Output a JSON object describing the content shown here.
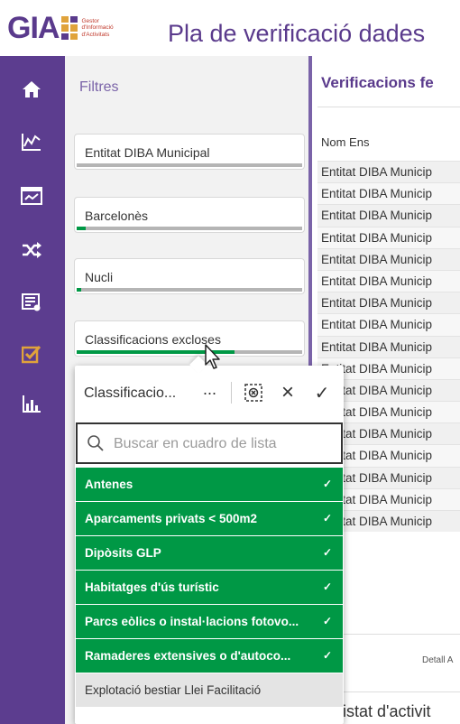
{
  "header": {
    "logo": "GIA",
    "logo_sub": [
      "Gestor",
      "d'Informació",
      "d'Activitats"
    ],
    "title": "Pla de verificació dades"
  },
  "rail": {
    "items": [
      "home-icon",
      "line-chart-icon",
      "dashboard-icon",
      "shuffle-icon",
      "report-icon",
      "checkbox-icon",
      "bar-chart-icon"
    ],
    "active_color": "#e0a33b"
  },
  "filters": {
    "title": "Filtres",
    "items": [
      {
        "label": "Entitat DIBA Municipal",
        "progress": 0
      },
      {
        "label": "Barcelonès",
        "progress": 0.04
      },
      {
        "label": "Nucli",
        "progress": 0.02
      },
      {
        "label": "Classificacions excloses",
        "progress": 0.7
      }
    ]
  },
  "table": {
    "title": "Verificacions fe",
    "column": "Nom Ens",
    "rows": [
      "Entitat DIBA Municip",
      "Entitat DIBA Municip",
      "Entitat DIBA Municip",
      "Entitat DIBA Municip",
      "Entitat DIBA Municip",
      "Entitat DIBA Municip",
      "Entitat DIBA Municip",
      "Entitat DIBA Municip",
      "Entitat DIBA Municip",
      "Entitat DIBA Municip",
      "Entitat DIBA Municip",
      "Entitat DIBA Municip",
      "Entitat DIBA Municip",
      "Entitat DIBA Municip",
      "Entitat DIBA Municip",
      "Entitat DIBA Municip",
      "Entitat DIBA Municip"
    ],
    "detail_link": "Detall A",
    "listat_title": "listat d'activit"
  },
  "popover": {
    "title": "Classificacio...",
    "more": "···",
    "close": "×",
    "confirm": "✓",
    "search_placeholder": "Buscar en cuadro de lista",
    "options": [
      {
        "label": "Antenes",
        "selected": true
      },
      {
        "label": "Aparcaments privats < 500m2",
        "selected": true
      },
      {
        "label": "Dipòsits GLP",
        "selected": true
      },
      {
        "label": "Habitatges d'ús turístic",
        "selected": true
      },
      {
        "label": "Parcs eòlics o instal·lacions fotovo...",
        "selected": true
      },
      {
        "label": "Ramaderes extensives o d'autoco...",
        "selected": true
      },
      {
        "label": "Explotació bestiar Llei Facilitació",
        "selected": false
      }
    ],
    "check_mark": "✓",
    "colors": {
      "selected": "#009845",
      "unselected": "#e4e4e4"
    }
  }
}
